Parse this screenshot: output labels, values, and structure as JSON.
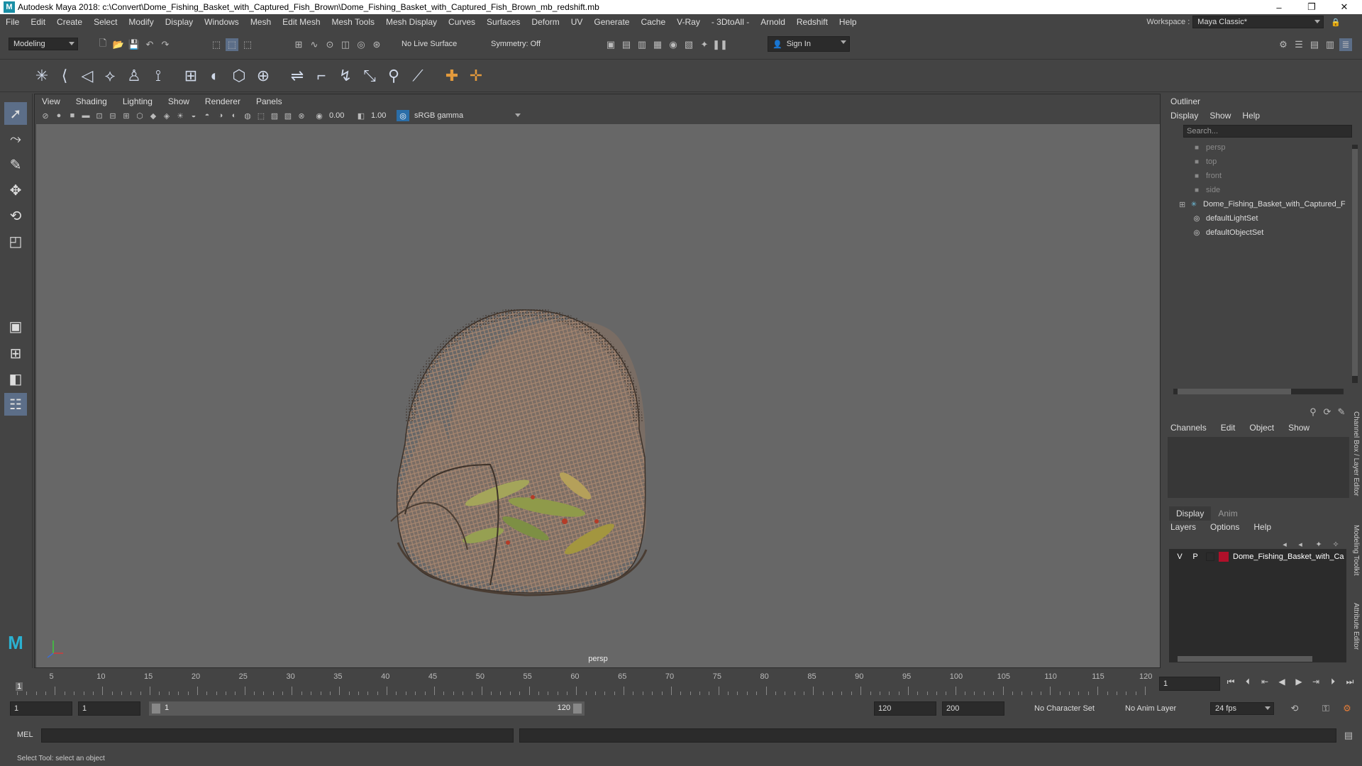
{
  "window": {
    "title": "Autodesk Maya 2018: c:\\Convert\\Dome_Fishing_Basket_with_Captured_Fish_Brown\\Dome_Fishing_Basket_with_Captured_Fish_Brown_mb_redshift.mb",
    "logo": "M",
    "minimize": "–",
    "maximize": "❐",
    "close": "✕"
  },
  "menubar": [
    "File",
    "Edit",
    "Create",
    "Select",
    "Modify",
    "Display",
    "Windows",
    "Mesh",
    "Edit Mesh",
    "Mesh Tools",
    "Mesh Display",
    "Curves",
    "Surfaces",
    "Deform",
    "UV",
    "Generate",
    "Cache",
    "V-Ray",
    "- 3DtoAll -",
    "Arnold",
    "Redshift",
    "Help"
  ],
  "workspace": {
    "label": "Workspace :",
    "value": "Maya Classic*"
  },
  "statusline": {
    "mode": "Modeling",
    "live_surface": "No Live Surface",
    "symmetry": "Symmetry: Off",
    "sign_in": "Sign In"
  },
  "viewport": {
    "menus": [
      "View",
      "Shading",
      "Lighting",
      "Show",
      "Renderer",
      "Panels"
    ],
    "exposure": "0.00",
    "gamma": "1.00",
    "color_space": "sRGB gamma",
    "camera": "persp"
  },
  "outliner": {
    "title": "Outliner",
    "menus": [
      "Display",
      "Show",
      "Help"
    ],
    "search_placeholder": "Search...",
    "items": [
      {
        "label": "persp",
        "kind": "camera"
      },
      {
        "label": "top",
        "kind": "camera"
      },
      {
        "label": "front",
        "kind": "camera"
      },
      {
        "label": "side",
        "kind": "camera"
      },
      {
        "label": "Dome_Fishing_Basket_with_Captured_F",
        "kind": "group"
      },
      {
        "label": "defaultLightSet",
        "kind": "set"
      },
      {
        "label": "defaultObjectSet",
        "kind": "set"
      }
    ]
  },
  "channelbox": {
    "menus": [
      "Channels",
      "Edit",
      "Object",
      "Show"
    ]
  },
  "layer_editor": {
    "tabs": [
      "Display",
      "Anim"
    ],
    "menus": [
      "Layers",
      "Options",
      "Help"
    ],
    "layer": {
      "v": "V",
      "p": "P",
      "name": "Dome_Fishing_Basket_with_Ca",
      "color": "#b0102a"
    }
  },
  "side_tabs": [
    "Channel Box / Layer Editor",
    "Modeling Toolkit",
    "Attribute Editor"
  ],
  "timeline": {
    "ticks": [
      5,
      10,
      15,
      20,
      25,
      30,
      35,
      40,
      45,
      50,
      55,
      60,
      65,
      70,
      75,
      80,
      85,
      90,
      95,
      100,
      105,
      110,
      115,
      120
    ],
    "start_marker": "1",
    "current_frame": "1"
  },
  "range": {
    "start": "1",
    "playback_start": "1",
    "slider_start": "1",
    "slider_end": "120",
    "playback_end": "120",
    "end": "200",
    "character_set": "No Character Set",
    "anim_layer": "No Anim Layer",
    "fps": "24 fps"
  },
  "cmdline": {
    "label": "MEL"
  },
  "helpline": {
    "text": "Select Tool: select an object"
  }
}
